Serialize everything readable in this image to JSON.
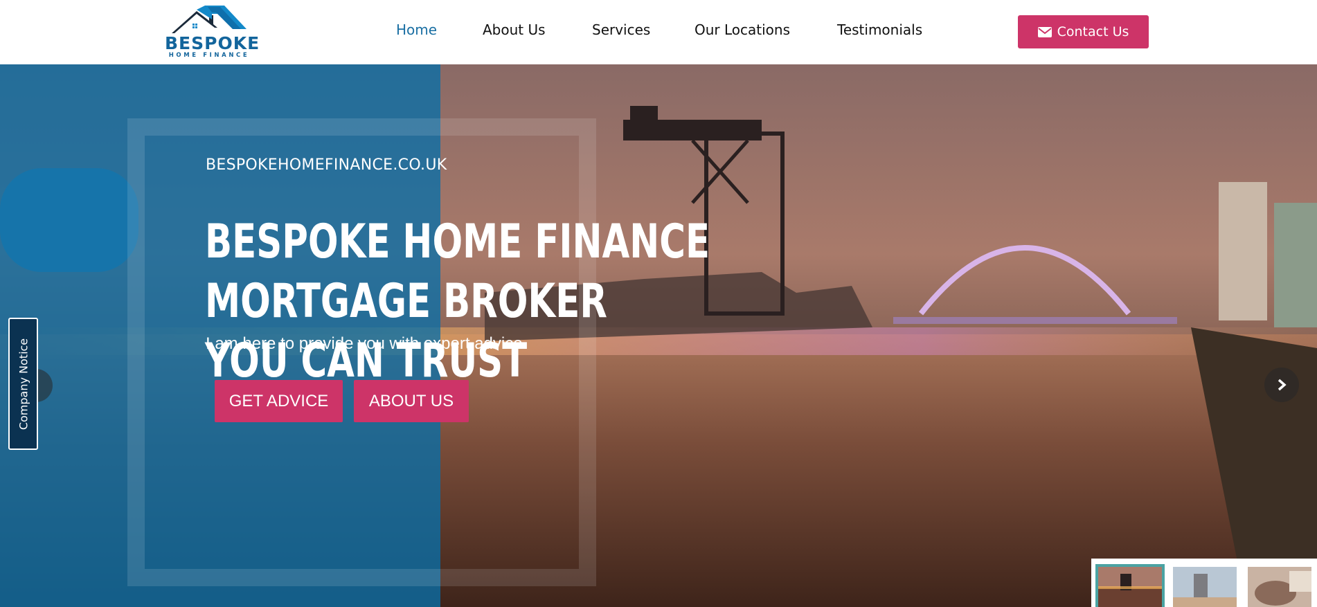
{
  "brand": {
    "name": "BESPOKE",
    "tagline": "HOME FINANCE",
    "color": "#13659c"
  },
  "nav": {
    "items": [
      {
        "label": "Home",
        "active": true
      },
      {
        "label": "About Us",
        "active": false
      },
      {
        "label": "Services",
        "active": false
      },
      {
        "label": "Our Locations",
        "active": false
      },
      {
        "label": "Testimonials",
        "active": false
      }
    ],
    "contact_label": "Contact Us",
    "contact_icon": "envelope-icon",
    "accent": "#cd3468"
  },
  "hero": {
    "domain": "BESPOKEHOMEFINANCE.CO.UK",
    "headline_line1": "BESPOKE HOME FINANCE MORTGAGE BROKER",
    "headline_line2": "YOU CAN TRUST",
    "subline": "I am here to provide you with expert advice.",
    "buttons": [
      {
        "label": "GET ADVICE"
      },
      {
        "label": "ABOUT US"
      }
    ],
    "panel_color": "#086ea8"
  },
  "notice_tab": {
    "label": "Company Notice"
  },
  "slider": {
    "next_icon": "chevron-right-icon",
    "prev_icon": "chevron-left-icon",
    "active_thumb": 1,
    "thumb_count": 3
  }
}
